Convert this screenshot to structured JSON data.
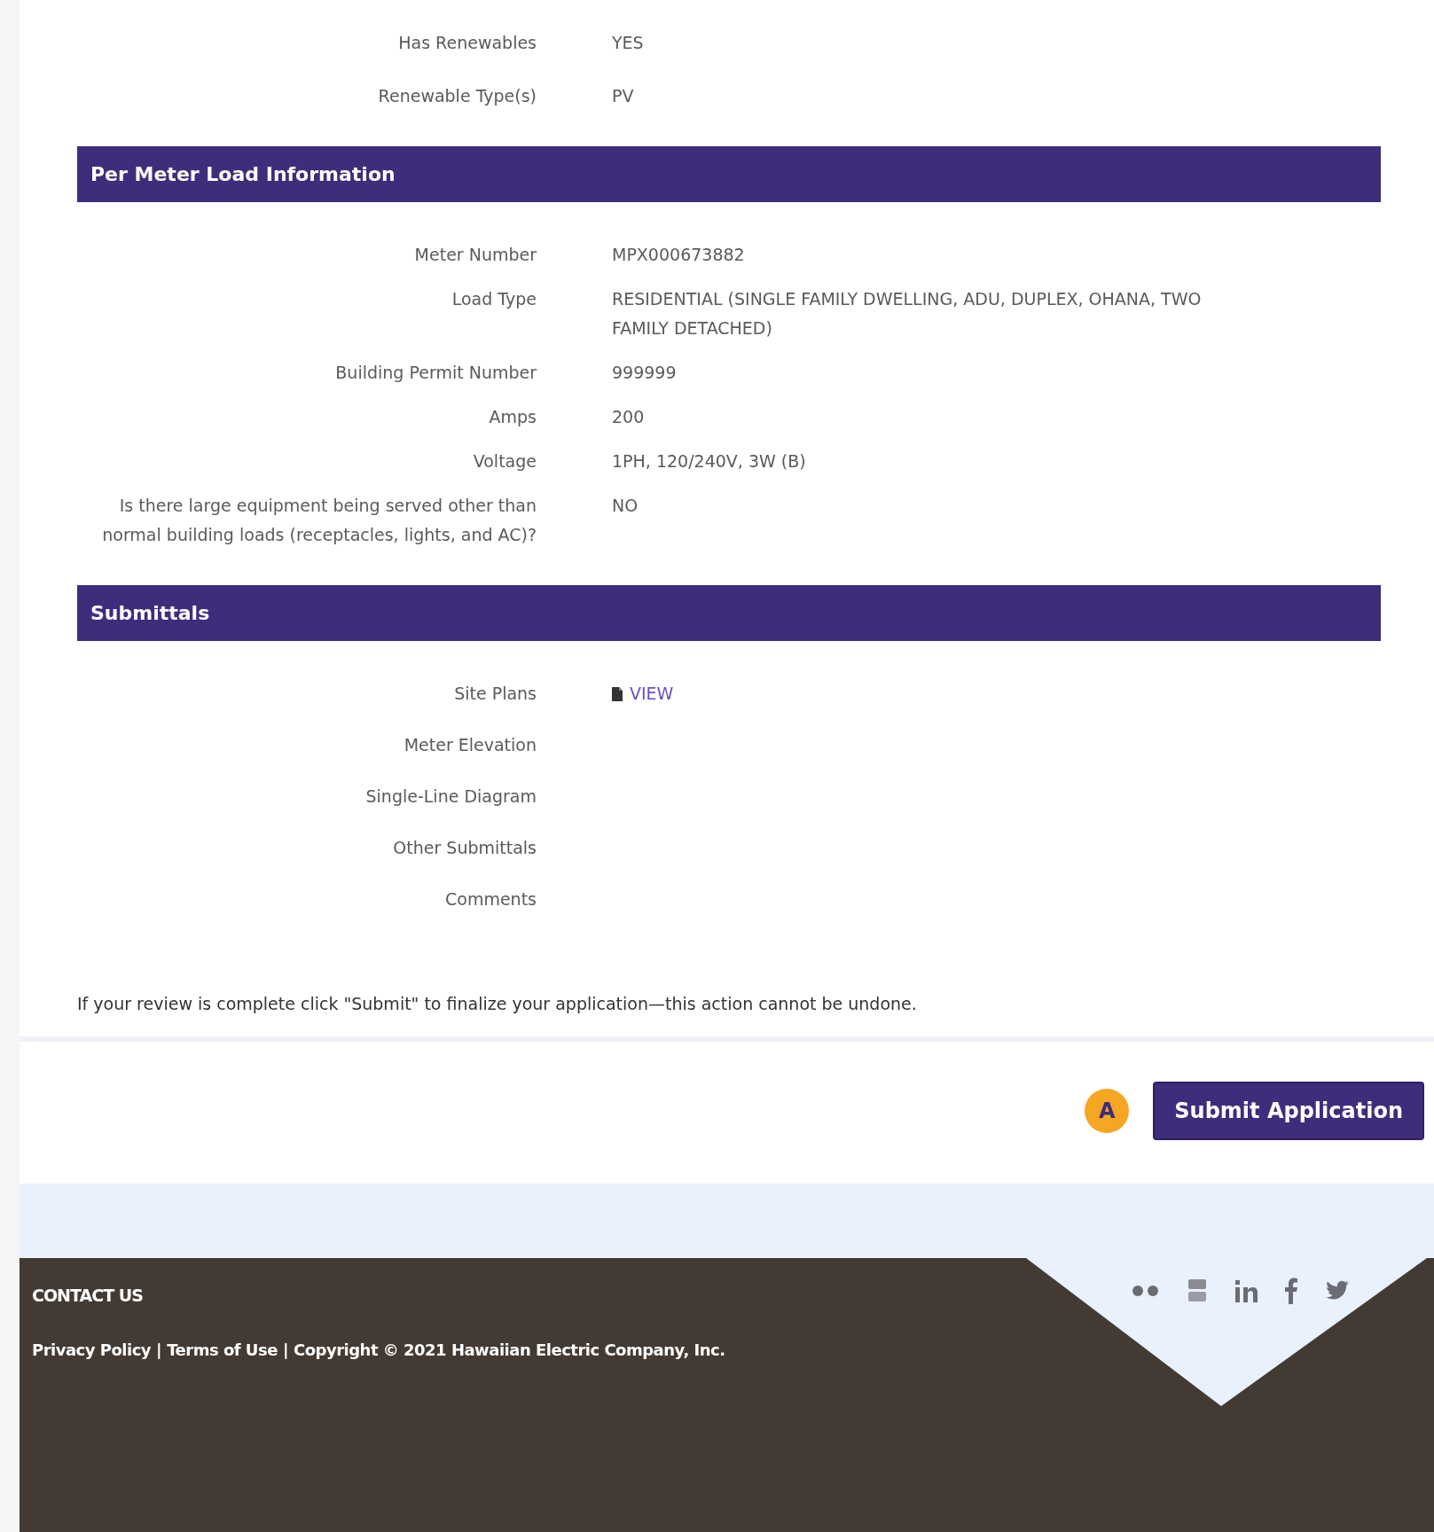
{
  "summary_rows": [
    {
      "label": "Has Renewables",
      "value": "YES"
    },
    {
      "label": "Renewable Type(s)",
      "value": "PV"
    }
  ],
  "sections": [
    {
      "title": "Per Meter Load Information",
      "rows": [
        {
          "label": "Meter Number",
          "value": "MPX000673882"
        },
        {
          "label": "Load Type",
          "value": "RESIDENTIAL (SINGLE FAMILY DWELLING, ADU, DUPLEX, OHANA, TWO FAMILY DETACHED)"
        },
        {
          "label": "Building Permit Number",
          "value": "999999"
        },
        {
          "label": "Amps",
          "value": "200"
        },
        {
          "label": "Voltage",
          "value": "1PH, 120/240V, 3W (B)"
        },
        {
          "label": "Is there large equipment being served other than normal building loads (receptacles, lights, and AC)?",
          "value": "NO"
        }
      ]
    },
    {
      "title": "Submittals",
      "rows": [
        {
          "label": "Site Plans",
          "kind": "file",
          "link": "VIEW"
        },
        {
          "label": "Meter Elevation"
        },
        {
          "label": "Single-Line Diagram"
        },
        {
          "label": "Other Submittals"
        },
        {
          "label": "Comments"
        }
      ]
    }
  ],
  "review_note": "If your review is complete click \"Submit\" to finalize your application—this action cannot be undone.",
  "marker": "A",
  "submit_button": "Submit Application",
  "footer": {
    "contact": "CONTACT US",
    "line": [
      {
        "link": "Privacy Policy"
      },
      {
        "separator": "|"
      },
      {
        "link": "Terms of Use"
      },
      {
        "separator": "|"
      },
      {
        "text": "Copyright © 2021 Hawaiian Electric Company, Inc."
      }
    ]
  }
}
